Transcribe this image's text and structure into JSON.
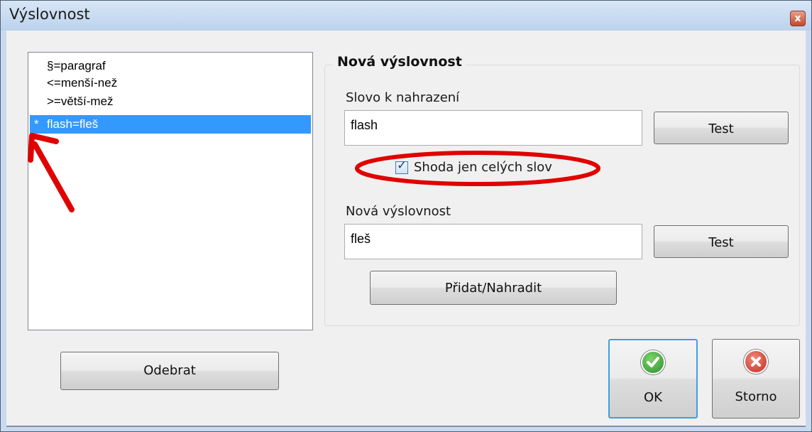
{
  "window": {
    "title": "Výslovnost",
    "close_symbol": "x"
  },
  "list": {
    "items": [
      {
        "marker": "",
        "label": "§=paragraf",
        "selected": false
      },
      {
        "marker": "",
        "label": "<=menší-než",
        "selected": false
      },
      {
        "marker": "",
        "label": ">=větší-mež",
        "selected": false
      },
      {
        "marker": "*",
        "label": "flash=fleš",
        "selected": true
      }
    ]
  },
  "group": {
    "title": "Nová výslovnost",
    "word_label": "Slovo k nahrazení",
    "word_value": "flash",
    "test_label": "Test",
    "whole_words_label": "Shoda jen celých slov",
    "whole_words_checked": true,
    "pron_label": "Nová výslovnost",
    "pron_value": "fleš",
    "test2_label": "Test",
    "add_replace_label": "Přidat/Nahradit"
  },
  "buttons": {
    "remove_label": "Odebrat",
    "ok_label": "OK",
    "cancel_label": "Storno"
  },
  "colors": {
    "selection": "#3399ff",
    "annotation": "#e00000",
    "ok_green": "#3aa640",
    "cancel_red": "#d83a2e"
  }
}
